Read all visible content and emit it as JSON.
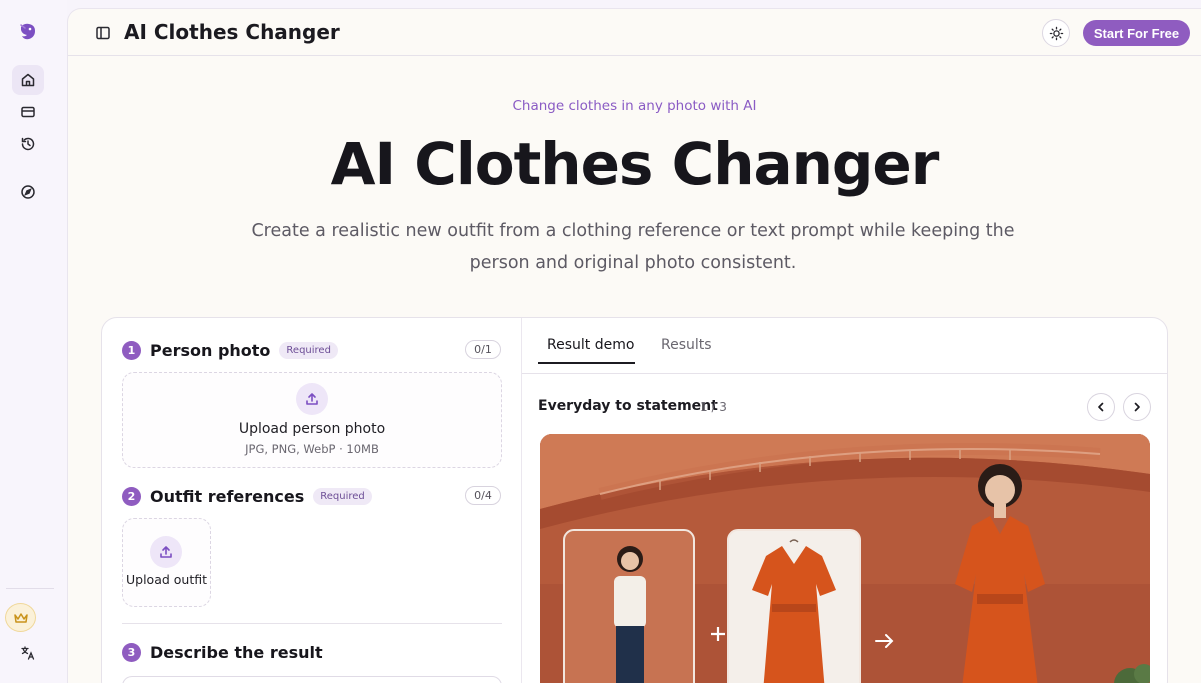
{
  "header": {
    "app_title": "AI Clothes Changer",
    "cta_label": "Start For Free"
  },
  "sidebar": {
    "items": [
      {
        "name": "home",
        "icon": "home-icon",
        "active": true
      },
      {
        "name": "billing",
        "icon": "card-icon",
        "active": false
      },
      {
        "name": "history",
        "icon": "history-icon",
        "active": false
      },
      {
        "name": "explore",
        "icon": "compass-icon",
        "active": false
      }
    ],
    "bottom": [
      {
        "name": "upgrade",
        "icon": "crown-icon"
      },
      {
        "name": "language",
        "icon": "translate-icon"
      }
    ]
  },
  "hero": {
    "eyebrow": "Change clothes in any photo with AI",
    "title": "AI Clothes Changer",
    "subtitle_line1": "Create a realistic new outfit from a clothing reference or text prompt while keeping the",
    "subtitle_line2": "person and original photo consistent."
  },
  "form": {
    "step1": {
      "num": "1",
      "title": "Person photo",
      "badge": "Required",
      "count": "0/1",
      "upload_title": "Upload person photo",
      "upload_hint": "JPG, PNG, WebP · 10MB"
    },
    "step2": {
      "num": "2",
      "title": "Outfit references",
      "badge": "Required",
      "count": "0/4",
      "upload_title": "Upload outfit"
    },
    "step3": {
      "num": "3",
      "title": "Describe the result"
    }
  },
  "results": {
    "tabs": [
      {
        "label": "Result demo",
        "active": true
      },
      {
        "label": "Results",
        "active": false
      }
    ],
    "demo_title": "Everyday to statement",
    "demo_counter": "1 / 3"
  },
  "colors": {
    "accent": "#8f5cc0",
    "background": "#fcfaf6",
    "terracotta": "#b75a3c",
    "dress": "#d6541c"
  }
}
